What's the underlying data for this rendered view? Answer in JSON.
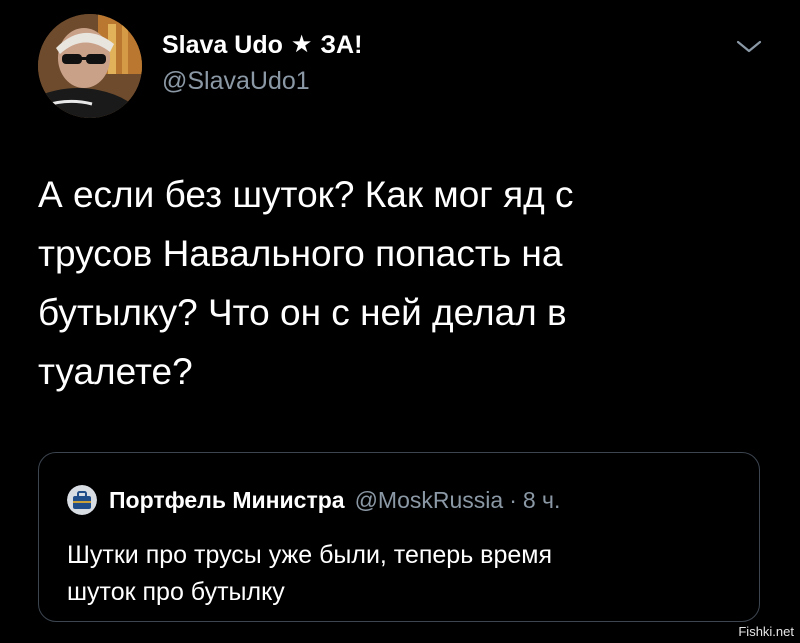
{
  "tweet": {
    "author_name": "Slava Udo",
    "author_suffix": "ЗА!",
    "author_handle": "@SlavaUdo1",
    "text": "А если без шуток? Как мог яд с\nтрусов Навального попасть на\nбутылку? Что он с ней делал в\nтуалете?"
  },
  "quoted": {
    "author_name": "Портфель Министра",
    "author_handle": "@MoskRussia",
    "separator": "·",
    "time": "8 ч.",
    "text": "Шутки про трусы уже были, теперь время\nшуток про бутылку"
  },
  "watermark": "Fishki.net",
  "icons": {
    "badge": "star-icon",
    "menu": "chevron-down-icon"
  },
  "colors": {
    "background": "#000000",
    "text_primary": "#ffffff",
    "text_secondary": "#8b98a5",
    "border": "#3d4550"
  }
}
